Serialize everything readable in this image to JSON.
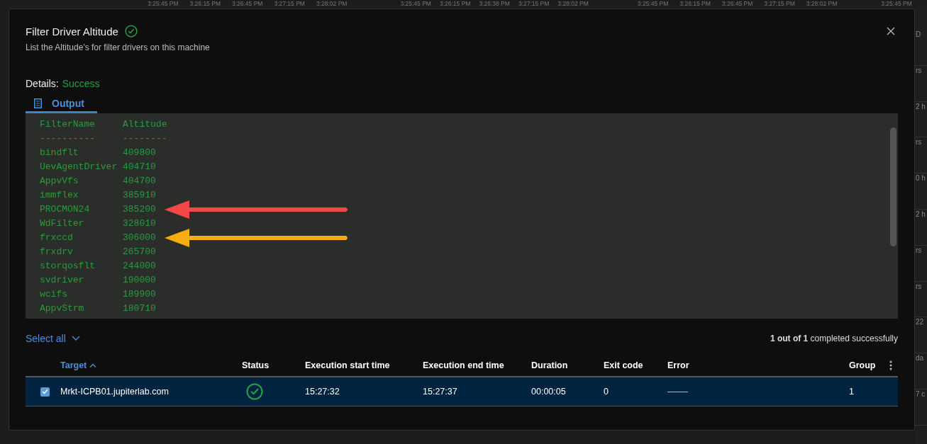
{
  "background": {
    "time_groups": [
      [
        "3:25:45 PM",
        "3:26:15 PM",
        "3:26:45 PM",
        "3:27:15 PM",
        "3:28:02 PM"
      ],
      [
        "3:25:45 PM",
        "3:26:15 PM",
        "3:26:38 PM",
        "3:27:15 PM",
        "3:28:02 PM"
      ],
      [
        "3:25:45 PM",
        "3:26:15 PM",
        "3:26:45 PM",
        "3:27:15 PM",
        "3:28:02 PM"
      ],
      [
        "3:25:45 PM"
      ]
    ],
    "side_fragments": [
      "D",
      "rs",
      "2 h",
      "rs",
      "0 h",
      "2 h",
      "rs",
      "rs",
      "22",
      "da",
      "7 c"
    ]
  },
  "dialog": {
    "title": "Filter Driver Altitude",
    "succeeded": true,
    "description": "List the Altitude's for filter drivers on this machine",
    "details_label": "Details:",
    "details_value": "Success",
    "tabs": [
      {
        "label": "Output",
        "selected": true
      }
    ],
    "output_lines": [
      {
        "text": "FilterName     Altitude"
      },
      {
        "text": "----------     --------"
      },
      {
        "text": "bindflt        409800"
      },
      {
        "text": "UevAgentDriver 404710"
      },
      {
        "text": "AppvVfs        404700"
      },
      {
        "text": "immflex        385910"
      },
      {
        "text": "PROCMON24      385200",
        "annotation": {
          "kind": "arrow",
          "color": "#f44848"
        }
      },
      {
        "text": "WdFilter       328010"
      },
      {
        "text": "frxccd         306000",
        "annotation": {
          "kind": "arrow",
          "color": "#f7ac12"
        }
      },
      {
        "text": "frxdrv         265700"
      },
      {
        "text": "storqosflt     244000"
      },
      {
        "text": "svdriver       190000"
      },
      {
        "text": "wcifs          189900"
      },
      {
        "text": "AppvStrm       180710"
      }
    ],
    "select_all": "Select all",
    "summary": "**1 out of 1** completed successfully",
    "table": {
      "columns": [
        {
          "label": "Target",
          "sorted": true
        },
        {
          "label": "Status",
          "sorted": false
        },
        {
          "label": "Execution start time",
          "sorted": false
        },
        {
          "label": "Execution end time",
          "sorted": false
        },
        {
          "label": "Duration",
          "sorted": false
        },
        {
          "label": "Exit code",
          "sorted": false
        },
        {
          "label": "Error",
          "sorted": false
        },
        {
          "label": "Group",
          "sorted": false
        }
      ],
      "rows": [
        {
          "selected": true,
          "target": "Mrkt-ICPB01.jupiterlab.com",
          "succeeded": true,
          "start": "15:27:32",
          "end": "15:27:37",
          "duration": "00:00:05",
          "exit_code": "0",
          "error": null,
          "group": "1"
        }
      ]
    }
  }
}
